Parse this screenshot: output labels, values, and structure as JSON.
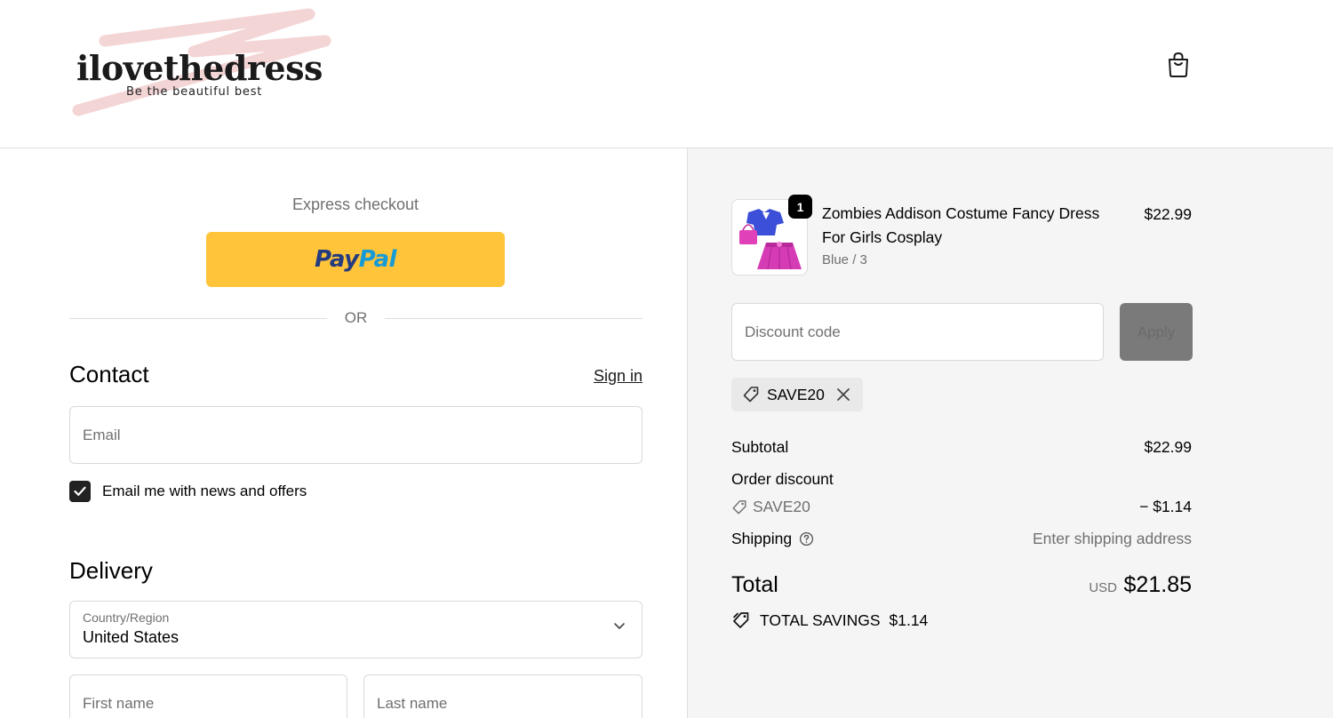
{
  "brand": {
    "name": "ilovethedress",
    "tagline": "Be the beautiful best"
  },
  "express": {
    "title": "Express checkout",
    "paypal_pay": "Pay",
    "paypal_pal": "Pal",
    "or_text": "OR"
  },
  "contact": {
    "title": "Contact",
    "signin_label": "Sign in",
    "email_placeholder": "Email",
    "newsletter_label": "Email me with news and offers",
    "newsletter_checked": true
  },
  "delivery": {
    "title": "Delivery",
    "country_label": "Country/Region",
    "country_value": "United States",
    "first_name_placeholder": "First name",
    "last_name_placeholder": "Last name"
  },
  "cart": {
    "item": {
      "name": "Zombies Addison Costume Fancy Dress For Girls Cosplay",
      "variant": "Blue / 3",
      "price": "$22.99",
      "quantity": "1"
    },
    "discount_placeholder": "Discount code",
    "apply_label": "Apply",
    "applied_code": "SAVE20"
  },
  "summary": {
    "subtotal_label": "Subtotal",
    "subtotal_value": "$22.99",
    "order_discount_label": "Order discount",
    "discount_code": "SAVE20",
    "discount_value": "− $1.14",
    "shipping_label": "Shipping",
    "shipping_value": "Enter shipping address",
    "total_label": "Total",
    "total_currency": "USD",
    "total_value": "$21.85",
    "savings_label": "TOTAL SAVINGS",
    "savings_value": "$1.14"
  },
  "colors": {
    "paypal_button": "#ffc439",
    "sidebar_bg": "#f5f5f5",
    "apply_button": "#7a7a7a"
  },
  "icons": [
    "shopping-bag-icon",
    "checkmark-icon",
    "chevron-down-icon",
    "tag-icon",
    "close-icon",
    "question-circle-icon",
    "savings-tag-icon",
    "product-image"
  ]
}
